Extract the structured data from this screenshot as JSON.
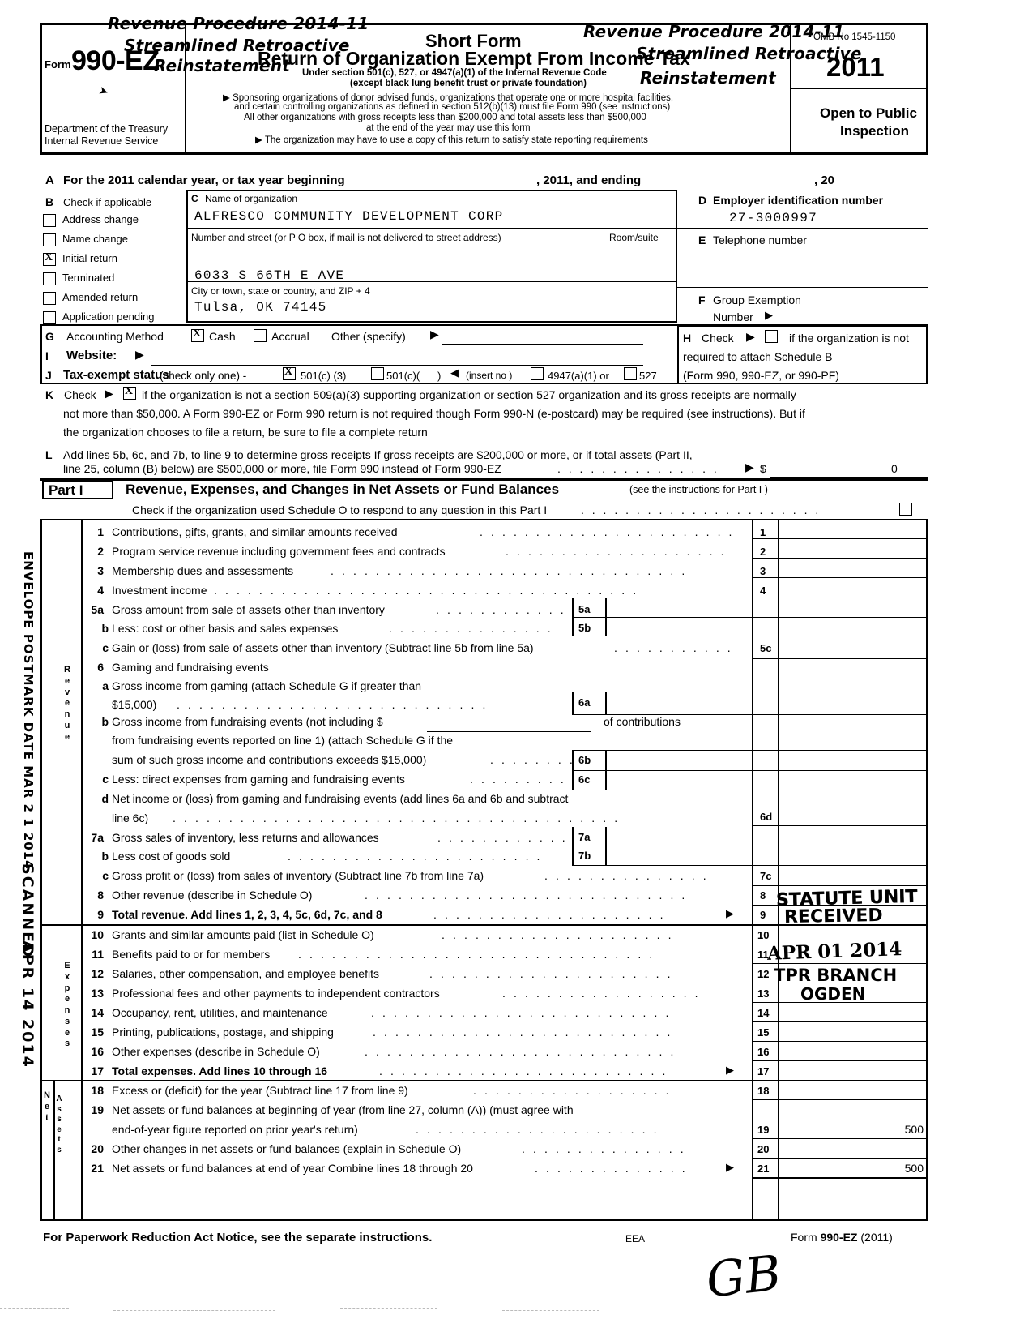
{
  "form": {
    "form_word": "Form",
    "form_number": "990-EZ",
    "short_form": "Short Form",
    "return_title": "Return of Organization Exempt From Income Tax",
    "under_section": "Under section 501(c), 527, or 4947(a)(1) of the Internal Revenue Code",
    "except_line": "(except black lung benefit trust or private foundation)",
    "bullet_1a": "Sponsoring organizations of donor advised funds, organizations that operate one or more hospital facilities,",
    "bullet_1b": "and certain controlling organizations as defined in section 512(b)(13) must file Form 990 (see instructions)",
    "bullet_1c": "All other organizations with gross receipts less than $200,000 and total assets less than $500,000",
    "bullet_1d": "at the end of the year may use this form",
    "bullet_2": "The organization may have to use a copy of this return to satisfy state reporting requirements",
    "dept_line1": "Department of the Treasury",
    "dept_line2": "Internal Revenue Service",
    "omb": "OMB No  1545-1150",
    "year": "2011",
    "open_to_public_1": "Open to Public",
    "open_to_public_2": "Inspection"
  },
  "stamps": {
    "rev_proc_1": "Revenue Procedure 2014-11",
    "rev_proc_2a": "Streamlined Retroactive",
    "rev_proc_2b": "Reinstatement",
    "rev_proc_3": "Revenue Procedure 2014-11",
    "rev_proc_4a": "Streamlined Retroactive",
    "rev_proc_4b": "Reinstatement",
    "envelope_postmark": "ENVELOPE POSTMARK DATE MAR 2 1 2014",
    "revenue_side_label": "Revenue",
    "expenses_side_label": "Expenses",
    "net_assets_side_label": "Net Assets",
    "scanned": "SCANNED",
    "scanned_date": "APR 14 2014",
    "statute_unit": "STATUTE UNIT",
    "received": "RECEIVED",
    "received_date": "APR 01 2014",
    "tpr_branch": "TPR BRANCH",
    "ogden": "OGDEN",
    "initials": "GB"
  },
  "section_a": {
    "letter": "A",
    "text": "For the 2011 calendar year, or tax year beginning",
    "mid": ", 2011, and ending",
    "end": ", 20"
  },
  "section_b": {
    "letter": "B",
    "heading": "Check if applicable",
    "items": [
      {
        "label": "Address change",
        "checked": false
      },
      {
        "label": "Name change",
        "checked": false
      },
      {
        "label": "Initial return",
        "checked": true
      },
      {
        "label": "Terminated",
        "checked": false
      },
      {
        "label": "Amended return",
        "checked": false
      },
      {
        "label": "Application pending",
        "checked": false
      }
    ]
  },
  "section_c": {
    "letter": "C",
    "name_label": "Name of organization",
    "org_name": "ALFRESCO COMMUNITY DEVELOPMENT CORP",
    "street_label": "Number and street (or P O  box, if mail is not delivered to street address)",
    "street": "6033 S 66TH E AVE",
    "room_suite_label": "Room/suite",
    "room_suite": "",
    "city_label": "City or town, state or country, and ZIP + 4",
    "city": "Tulsa, OK 74145"
  },
  "section_d": {
    "letter": "D",
    "label": "Employer identification number",
    "value": "27-3000997"
  },
  "section_e": {
    "letter": "E",
    "label": "Telephone number",
    "value": ""
  },
  "section_f": {
    "letter": "F",
    "label": "Group Exemption",
    "label2": "Number"
  },
  "section_g": {
    "letter": "G",
    "label": "Accounting Method",
    "cash_label": "Cash",
    "cash_checked": true,
    "accrual_label": "Accrual",
    "accrual_checked": false,
    "other_label": "Other (specify)",
    "other_value": ""
  },
  "section_h": {
    "letter": "H",
    "check_label": "Check",
    "checked": false,
    "text1": "if the organization is not",
    "text2": "required to attach Schedule B",
    "text3": "(Form 990, 990-EZ, or 990-PF)"
  },
  "section_i": {
    "letter": "I",
    "label": "Website:",
    "value": ""
  },
  "section_j": {
    "letter": "J",
    "label": "Tax-exempt status",
    "sub": "(check only one) -",
    "opt1": "501(c) (3)",
    "opt1_checked": true,
    "opt2": "501(c)(",
    "opt2_checked": false,
    "paren": ")",
    "insert_no": "(insert no )",
    "opt3": "4947(a)(1) or",
    "opt3_checked": false,
    "opt4": "527",
    "opt4_checked": false
  },
  "section_k": {
    "letter": "K",
    "check_label": "Check",
    "checked": true,
    "line1": "if the organization is not a section 509(a)(3) supporting organization or section 527 organization and its gross receipts are normally",
    "line2": "not more than $50,000. A Form 990-EZ or Form 990 return is not required though Form 990-N (e-postcard) may be required (see instructions). But if",
    "line3": "the organization chooses to file a return, be sure to file a complete return"
  },
  "section_l": {
    "letter": "L",
    "line1": "Add lines 5b, 6c, and 7b, to line 9 to determine gross receipts  If gross receipts are $200,000 or more, or if total assets (Part II,",
    "line2": "line 25, column (B) below) are $500,000 or more, file Form 990 instead of Form 990-EZ",
    "dollar": "$",
    "value": "0"
  },
  "part1": {
    "label": "Part I",
    "title": "Revenue, Expenses, and Changes in Net Assets or Fund Balances",
    "subtitle": "(see the instructions for Part I )",
    "schedule_o_check": "Check if the organization used Schedule O to respond to any question in this Part I",
    "revenue_rows": [
      {
        "num": "1",
        "sub": "",
        "text": "Contributions, gifts, grants, and similar amounts received",
        "boxnum": "1",
        "value": ""
      },
      {
        "num": "2",
        "sub": "",
        "text": "Program service revenue including government fees and contracts",
        "boxnum": "2",
        "value": ""
      },
      {
        "num": "3",
        "sub": "",
        "text": "Membership dues and assessments",
        "boxnum": "3",
        "value": ""
      },
      {
        "num": "4",
        "sub": "",
        "text": "Investment income",
        "boxnum": "4",
        "value": ""
      },
      {
        "num": "5a",
        "sub": "",
        "text": "Gross amount from sale of assets other than inventory",
        "boxnum": "5a",
        "value": ""
      },
      {
        "num": "",
        "sub": "b",
        "text": "Less: cost or other basis and sales expenses",
        "boxnum": "5b",
        "value": ""
      },
      {
        "num": "",
        "sub": "c",
        "text": "Gain or (loss) from sale of assets other than inventory (Subtract line 5b from line 5a)",
        "boxnum": "5c",
        "value": ""
      },
      {
        "num": "6",
        "sub": "",
        "text": "Gaming and fundraising events",
        "boxnum": "",
        "value": ""
      },
      {
        "num": "",
        "sub": "a",
        "text": "Gross income from gaming (attach Schedule G if greater than",
        "boxnum": "",
        "value": ""
      },
      {
        "num": "",
        "sub": "",
        "text": "$15,000)",
        "boxnum": "6a",
        "value": ""
      },
      {
        "num": "",
        "sub": "b",
        "text": "Gross income from fundraising events (not including $",
        "boxnum": "",
        "value": ""
      },
      {
        "num": "",
        "sub": "",
        "text": "from fundraising events reported on line 1) (attach Schedule G if the",
        "boxnum": "",
        "value": ""
      },
      {
        "num": "",
        "sub": "",
        "text": "sum of such gross income and contributions exceeds $15,000)",
        "boxnum": "6b",
        "value": ""
      },
      {
        "num": "",
        "sub": "c",
        "text": "Less: direct expenses from gaming and fundraising events",
        "boxnum": "6c",
        "value": ""
      },
      {
        "num": "",
        "sub": "d",
        "text": "Net income or (loss) from gaming and fundraising events (add lines 6a and 6b and subtract",
        "boxnum": "",
        "value": ""
      },
      {
        "num": "",
        "sub": "",
        "text": "line 6c)",
        "boxnum": "6d",
        "value": ""
      },
      {
        "num": "7a",
        "sub": "",
        "text": "Gross sales of inventory, less returns and allowances",
        "boxnum": "7a",
        "value": ""
      },
      {
        "num": "",
        "sub": "b",
        "text": "Less  cost of goods sold",
        "boxnum": "7b",
        "value": ""
      },
      {
        "num": "",
        "sub": "c",
        "text": "Gross profit or (loss) from sales of inventory (Subtract line 7b from line 7a)",
        "boxnum": "7c",
        "value": ""
      },
      {
        "num": "8",
        "sub": "",
        "text": "Other revenue (describe in Schedule O)",
        "boxnum": "8",
        "value": ""
      },
      {
        "num": "9",
        "sub": "",
        "text": "Total revenue.  Add lines 1, 2, 3, 4, 5c, 6d, 7c, and 8",
        "boxnum": "9",
        "value": "",
        "bold_prefix": "Total revenue."
      }
    ],
    "line6b_of_contributions": "of contributions",
    "expense_rows": [
      {
        "num": "10",
        "text": "Grants and similar amounts paid (list in Schedule O)",
        "boxnum": "10",
        "value": ""
      },
      {
        "num": "11",
        "text": "Benefits paid to or for members",
        "boxnum": "11",
        "value": ""
      },
      {
        "num": "12",
        "text": "Salaries, other compensation, and employee benefits",
        "boxnum": "12",
        "value": ""
      },
      {
        "num": "13",
        "text": "Professional fees and other payments to independent contractors",
        "boxnum": "13",
        "value": ""
      },
      {
        "num": "14",
        "text": "Occupancy, rent, utilities, and maintenance",
        "boxnum": "14",
        "value": ""
      },
      {
        "num": "15",
        "text": "Printing, publications, postage, and shipping",
        "boxnum": "15",
        "value": ""
      },
      {
        "num": "16",
        "text": "Other expenses (describe in Schedule O)",
        "boxnum": "16",
        "value": ""
      },
      {
        "num": "17",
        "text": "Total expenses.  Add lines 10 through 16",
        "boxnum": "17",
        "value": ""
      }
    ],
    "netassets_rows": [
      {
        "num": "18",
        "text": "Excess or (deficit) for the year (Subtract line 17 from line 9)",
        "boxnum": "18",
        "value": ""
      },
      {
        "num": "19",
        "text": "Net assets or fund balances at beginning of year (from line 27, column (A)) (must agree with",
        "boxnum": "",
        "value": ""
      },
      {
        "num": "",
        "text": "end-of-year figure reported on prior year's return)",
        "boxnum": "19",
        "value": "500"
      },
      {
        "num": "20",
        "text": "Other changes in net assets or fund balances (explain in Schedule O)",
        "boxnum": "20",
        "value": ""
      },
      {
        "num": "21",
        "text": "Net assets or fund balances at end of year  Combine lines 18 through 20",
        "boxnum": "21",
        "value": "500"
      }
    ]
  },
  "footer": {
    "left": "For Paperwork Reduction Act Notice, see the separate instructions.",
    "eea": "EEA",
    "right_prefix": "Form ",
    "right_bold": "990-EZ",
    "right_suffix": " (2011)"
  }
}
